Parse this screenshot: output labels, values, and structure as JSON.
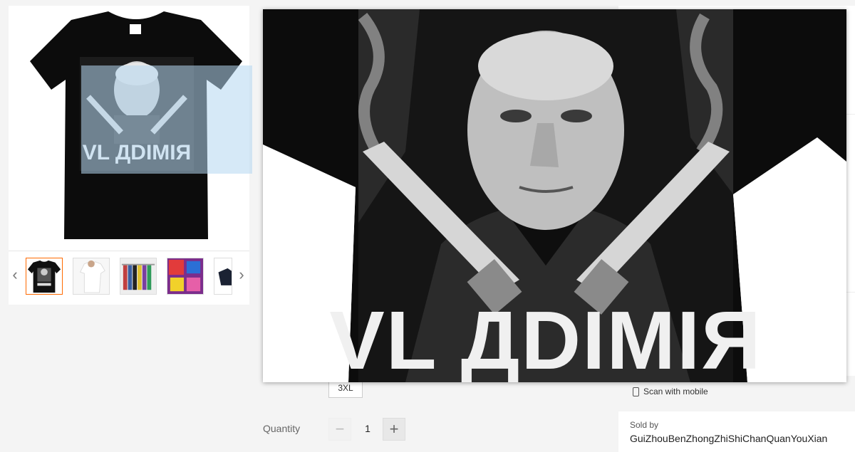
{
  "product": {
    "print_text": "VL ДDIMIЯ",
    "size_option": "3XL",
    "quantity_label": "Quantity",
    "quantity_value": "1",
    "minus_symbol": "−",
    "plus_symbol": "+"
  },
  "gallery": {
    "prev_symbol": "‹",
    "next_symbol": "›",
    "thumbnails": [
      {
        "name": "black-tshirt",
        "active": true
      },
      {
        "name": "white-tshirt",
        "active": false
      },
      {
        "name": "tshirt-rack",
        "active": false
      },
      {
        "name": "colorful-print",
        "active": false
      },
      {
        "name": "dark-tshirt-partial",
        "active": false
      }
    ]
  },
  "seller": {
    "scan_label": "Scan with mobile",
    "sold_by_label": "Sold by",
    "seller_name": "GuiZhouBenZhongZhiShiChanQuanYouXian"
  },
  "colors": {
    "active_thumb_border": "#ff6a00",
    "shirt": "#0c0c0c",
    "lens": "#b4d7f0"
  }
}
